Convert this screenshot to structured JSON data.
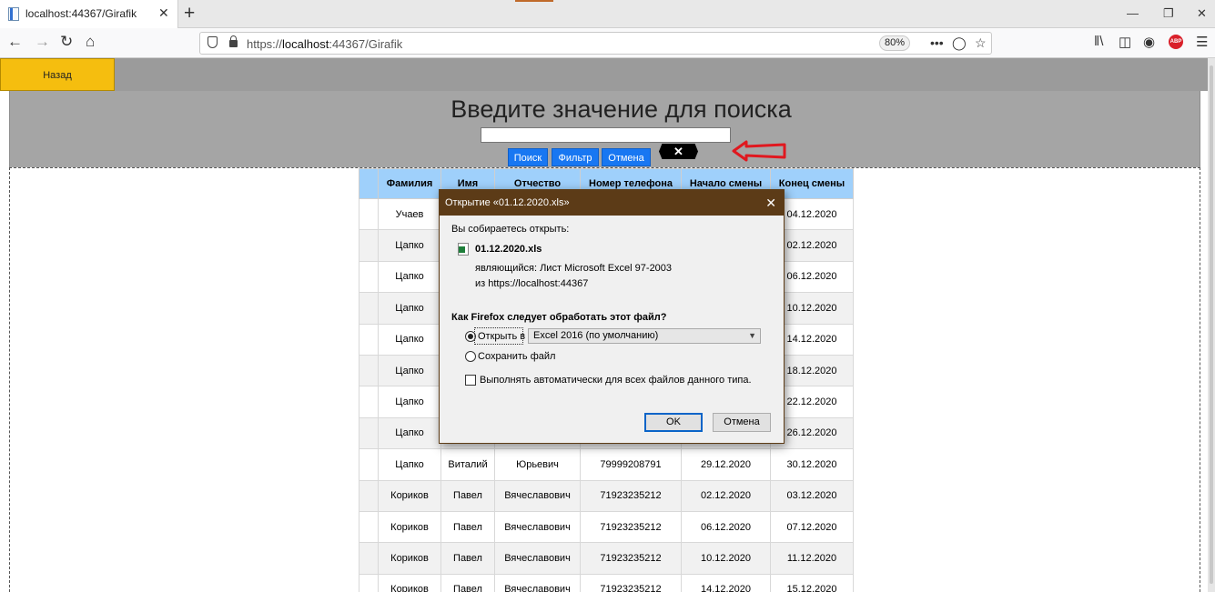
{
  "browser": {
    "tab_title": "localhost:44367/Girafik",
    "tab_close": "✕",
    "new_tab": "+",
    "url_prefix": "https://",
    "url_host": "localhost",
    "url_rest": ":44367/Girafik",
    "zoom": "80%",
    "icons": [
      "back-arrow-icon",
      "forward-arrow-icon",
      "reload-icon",
      "home-icon",
      "shield-icon",
      "lock-icon",
      "page-actions-icon",
      "pocket-icon",
      "bookmark-star-icon",
      "library-icon",
      "sidebar-icon",
      "account-icon",
      "adblock-icon",
      "menu-icon"
    ]
  },
  "page": {
    "back_label": "Назад",
    "search_title": "Введите значение для поиска",
    "search_value": "",
    "buttons": {
      "search": "Поиск",
      "filter": "Фильтр",
      "cancel": "Отмена"
    },
    "export_icon_label": "✕",
    "accent_color": "#f5be0f",
    "button_color": "#1877f2"
  },
  "table": {
    "headers": [
      "",
      "Фамилия",
      "Имя",
      "Отчество",
      "Номер телефона",
      "Начало смены",
      "Конец смены"
    ],
    "rows": [
      [
        "",
        "Учаев",
        "",
        "",
        "",
        "",
        "04.12.2020"
      ],
      [
        "",
        "Цапко",
        "",
        "",
        "",
        "",
        "02.12.2020"
      ],
      [
        "",
        "Цапко",
        "",
        "",
        "",
        "",
        "06.12.2020"
      ],
      [
        "",
        "Цапко",
        "",
        "",
        "",
        "",
        "10.12.2020"
      ],
      [
        "",
        "Цапко",
        "",
        "",
        "",
        "",
        "14.12.2020"
      ],
      [
        "",
        "Цапко",
        "",
        "",
        "",
        "",
        "18.12.2020"
      ],
      [
        "",
        "Цапко",
        "",
        "",
        "",
        "",
        "22.12.2020"
      ],
      [
        "",
        "Цапко",
        "",
        "",
        "",
        "",
        "26.12.2020"
      ],
      [
        "",
        "Цапко",
        "Виталий",
        "Юрьевич",
        "79999208791",
        "29.12.2020",
        "30.12.2020"
      ],
      [
        "",
        "Кориков",
        "Павел",
        "Вячеславович",
        "71923235212",
        "02.12.2020",
        "03.12.2020"
      ],
      [
        "",
        "Кориков",
        "Павел",
        "Вячеславович",
        "71923235212",
        "06.12.2020",
        "07.12.2020"
      ],
      [
        "",
        "Кориков",
        "Павел",
        "Вячеславович",
        "71923235212",
        "10.12.2020",
        "11.12.2020"
      ],
      [
        "",
        "Кориков",
        "Павел",
        "Вячеславович",
        "71923235212",
        "14.12.2020",
        "15.12.2020"
      ]
    ]
  },
  "dialog": {
    "title": "Открытие «01.12.2020.xls»",
    "intro": "Вы собираетесь открыть:",
    "file_name": "01.12.2020.xls",
    "file_type": "являющийся:  Лист Microsoft Excel 97-2003",
    "file_source": "из  https://localhost:44367",
    "question": "Как Firefox следует обработать этот файл?",
    "open_with_label": "Открыть в",
    "open_with_app": "Excel 2016 (по умолчанию)",
    "save_label": "Сохранить файл",
    "auto_label": "Выполнять автоматически для всех файлов данного типа.",
    "ok_label": "OK",
    "cancel_label": "Отмена"
  }
}
